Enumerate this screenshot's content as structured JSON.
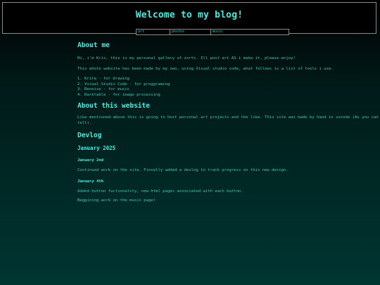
{
  "header": {
    "title": "Welcome to my blog!"
  },
  "nav": {
    "items": [
      "art",
      "photos",
      "music"
    ]
  },
  "about_me": {
    "heading": "About me",
    "intro": "Hi, i'm Kris, this is my personal gallery of sorts. Ill post art AS i make it, please enjoy!",
    "tools_intro": "This whole website has been made by my own, using Visual studio code, what follows is a list of tools i use.",
    "tools": [
      "Krita - for drawing",
      "Visual Studio Code - for proggraming",
      "Renoise - for music",
      "Darktable - for image processing"
    ]
  },
  "about_site": {
    "heading": "About this website",
    "text": "Like mentioned above this is going to host personal art projects and the like. This site was made by hand in vscode (As you can tell)."
  },
  "devlog": {
    "heading": "Devlog",
    "month": "January 2025",
    "entries": [
      {
        "date": "January 2nd",
        "paragraphs": [
          "Continued work on the site. Finnally added a devlog to track progress on this new design."
        ]
      },
      {
        "date": "January 4th",
        "paragraphs": [
          "Added button fuctionality, new html pages associated with each button.",
          "Beggining work on the music page!"
        ]
      }
    ]
  }
}
